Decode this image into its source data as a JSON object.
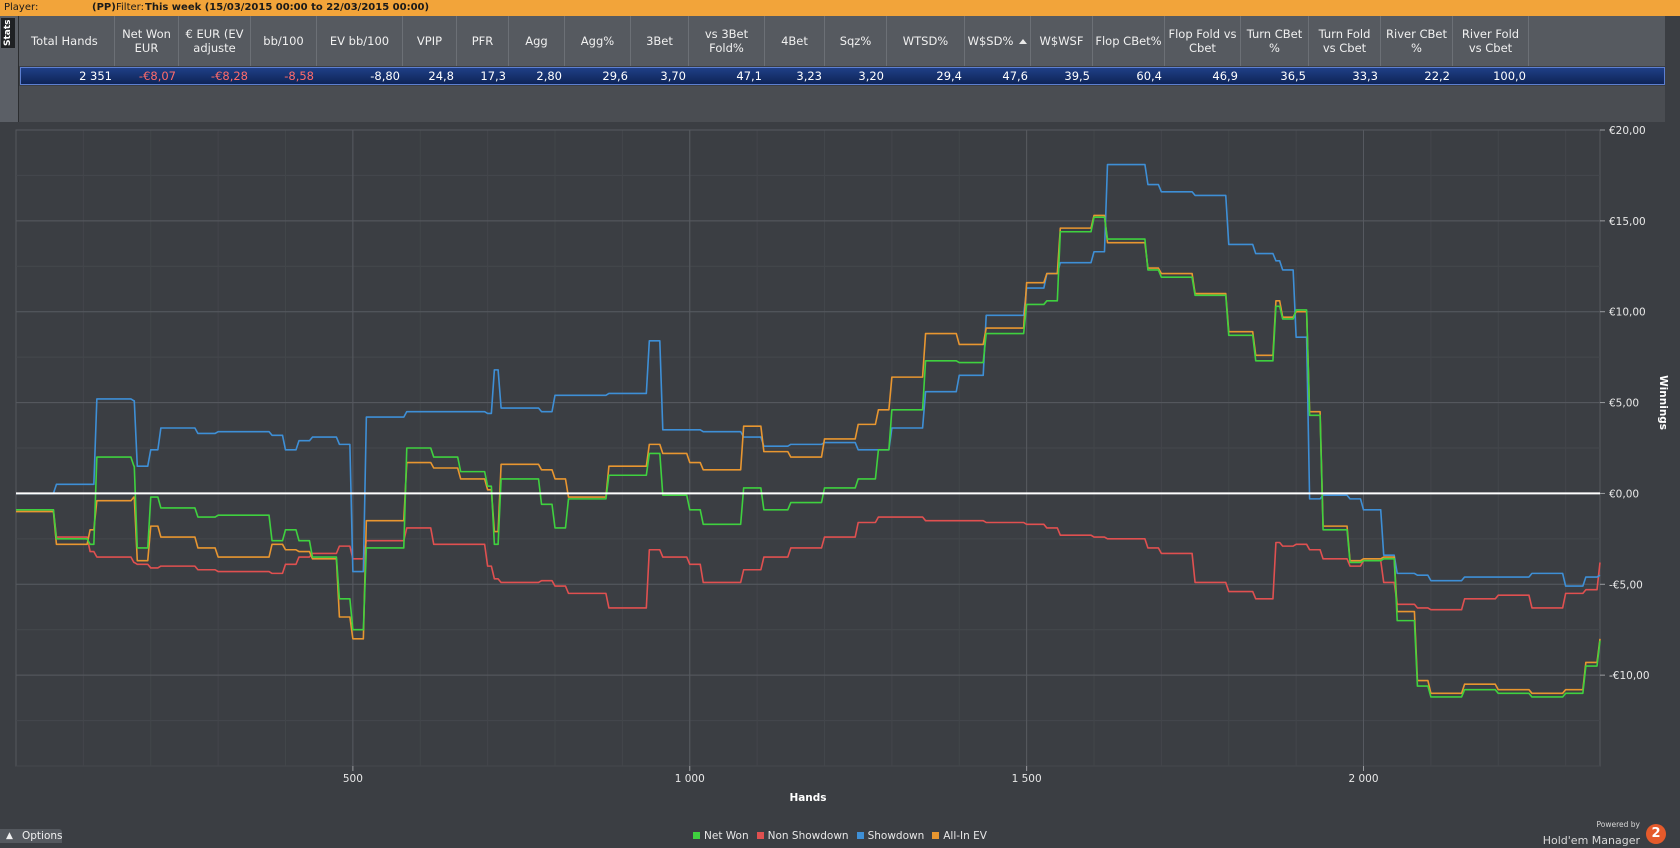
{
  "topbar": {
    "player_label": "Player:",
    "player_site": "(PP)",
    "filter_label": "Filter:",
    "filter_value": "This week (15/03/2015 00:00 to 22/03/2015 00:00)"
  },
  "side_tab": {
    "label": "Stats"
  },
  "stats": {
    "columns": [
      {
        "key": "total_hands",
        "label": "Total Hands"
      },
      {
        "key": "net_won",
        "label": "Net Won EUR"
      },
      {
        "key": "eur_ev",
        "label": "€ EUR (EV adjuste"
      },
      {
        "key": "bb100",
        "label": "bb/100"
      },
      {
        "key": "ev_bb100",
        "label": "EV bb/100"
      },
      {
        "key": "vpip",
        "label": "VPIP"
      },
      {
        "key": "pfr",
        "label": "PFR"
      },
      {
        "key": "agg",
        "label": "Agg"
      },
      {
        "key": "aggp",
        "label": "Agg%"
      },
      {
        "key": "threebet",
        "label": "3Bet"
      },
      {
        "key": "vs3bet",
        "label": "vs 3Bet Fold%"
      },
      {
        "key": "fourbet",
        "label": "4Bet"
      },
      {
        "key": "sqz",
        "label": "Sqz%"
      },
      {
        "key": "wtsd",
        "label": "WTSD%"
      },
      {
        "key": "wsd",
        "label": "W$SD%"
      },
      {
        "key": "wwsf",
        "label": "W$WSF"
      },
      {
        "key": "flop_cbet",
        "label": "Flop CBet%"
      },
      {
        "key": "flop_fold",
        "label": "Flop Fold vs Cbet"
      },
      {
        "key": "turn_cbet",
        "label": "Turn CBet %"
      },
      {
        "key": "turn_fold",
        "label": "Turn Fold vs Cbet"
      },
      {
        "key": "river_cbet",
        "label": "River CBet %"
      },
      {
        "key": "river_fold",
        "label": "River Fold vs Cbet"
      }
    ],
    "sorted_column": "W$SD%",
    "row": [
      "2 351",
      "-€8,07",
      "-€8,28",
      "-8,58",
      "-8,80",
      "24,8",
      "17,3",
      "2,80",
      "29,6",
      "3,70",
      "47,1",
      "3,23",
      "3,20",
      "29,4",
      "47,6",
      "39,5",
      "60,4",
      "46,9",
      "36,5",
      "33,3",
      "22,2",
      "100,0"
    ]
  },
  "chart_data": {
    "type": "line",
    "xlabel": "Hands",
    "ylabel": "Winnings",
    "xlim": [
      0,
      2351
    ],
    "ylim": [
      -15,
      20
    ],
    "x_ticks": [
      500,
      1000,
      1500,
      2000
    ],
    "x_tick_labels": [
      "500",
      "1 000",
      "1 500",
      "2 000"
    ],
    "y_ticks": [
      20,
      15,
      10,
      5,
      0,
      -5,
      -10
    ],
    "y_tick_labels": [
      "€20,00",
      "€15,00",
      "€10,00",
      "€5,00",
      "€0,00",
      "-€5,00",
      "-€10,00"
    ],
    "grid": true,
    "legend_position": "bottom-center",
    "x": [
      0,
      60,
      110,
      120,
      175,
      180,
      200,
      215,
      270,
      300,
      380,
      400,
      420,
      440,
      480,
      500,
      520,
      580,
      620,
      660,
      700,
      710,
      720,
      780,
      800,
      820,
      880,
      940,
      960,
      1000,
      1020,
      1080,
      1110,
      1150,
      1200,
      1250,
      1280,
      1300,
      1350,
      1400,
      1440,
      1500,
      1530,
      1550,
      1600,
      1620,
      1680,
      1700,
      1750,
      1800,
      1840,
      1870,
      1880,
      1900,
      1920,
      1940,
      1980,
      2000,
      2030,
      2050,
      2080,
      2100,
      2150,
      2200,
      2250,
      2300,
      2330,
      2351
    ],
    "series": [
      {
        "name": "Net Won",
        "color": "#3fd13f",
        "values": [
          -0.9,
          -2.5,
          -2.8,
          2.0,
          1.5,
          -3.0,
          -0.2,
          -0.8,
          -1.3,
          -1.2,
          -2.6,
          -2.0,
          -2.6,
          -3.5,
          -5.8,
          -7.5,
          -3.0,
          2.5,
          2.0,
          1.2,
          0.4,
          -2.8,
          0.8,
          -0.6,
          -1.9,
          -0.3,
          1.0,
          2.2,
          -0.1,
          -0.9,
          -1.7,
          0.3,
          -0.9,
          -0.5,
          0.3,
          0.8,
          2.4,
          4.6,
          7.3,
          7.2,
          8.8,
          10.4,
          10.6,
          14.4,
          15.2,
          14.0,
          12.3,
          11.9,
          10.9,
          8.7,
          7.3,
          10.3,
          9.6,
          10.1,
          4.3,
          -2.0,
          -3.8,
          -3.7,
          -3.6,
          -7.0,
          -10.6,
          -11.2,
          -10.8,
          -11.0,
          -11.2,
          -11.0,
          -9.5,
          -8.1
        ]
      },
      {
        "name": "Non Showdown",
        "color": "#e05050",
        "values": [
          -0.9,
          -2.4,
          -3.2,
          -3.5,
          -3.8,
          -3.9,
          -4.1,
          -4.0,
          -4.2,
          -4.3,
          -4.4,
          -3.9,
          -3.5,
          -3.3,
          -2.9,
          -3.6,
          -2.6,
          -1.9,
          -2.8,
          -2.8,
          -4.0,
          -4.7,
          -4.9,
          -4.8,
          -5.1,
          -5.5,
          -6.3,
          -3.1,
          -3.5,
          -3.9,
          -4.9,
          -4.2,
          -3.5,
          -3.0,
          -2.4,
          -1.6,
          -1.3,
          -1.3,
          -1.5,
          -1.5,
          -1.6,
          -1.7,
          -1.9,
          -2.3,
          -2.4,
          -2.5,
          -3.0,
          -3.3,
          -4.9,
          -5.4,
          -5.8,
          -2.7,
          -2.9,
          -2.8,
          -3.1,
          -3.6,
          -4.0,
          -3.7,
          -4.9,
          -6.1,
          -6.3,
          -6.4,
          -5.8,
          -5.6,
          -6.3,
          -5.5,
          -5.3,
          -3.8
        ]
      },
      {
        "name": "Showdown",
        "color": "#3e8fd6",
        "values": [
          0.0,
          0.5,
          0.5,
          5.2,
          5.1,
          1.5,
          2.4,
          3.6,
          3.3,
          3.4,
          3.2,
          2.4,
          2.9,
          3.1,
          2.7,
          -4.3,
          4.2,
          4.5,
          4.5,
          4.5,
          4.4,
          6.8,
          4.7,
          4.5,
          5.4,
          5.4,
          5.5,
          8.4,
          3.5,
          3.5,
          3.4,
          3.1,
          2.6,
          2.7,
          2.8,
          2.4,
          2.4,
          3.6,
          5.6,
          6.5,
          9.8,
          11.3,
          12.1,
          12.7,
          13.3,
          18.1,
          17.0,
          16.6,
          16.4,
          13.7,
          13.2,
          12.8,
          12.3,
          8.6,
          -0.3,
          -0.1,
          -0.3,
          -0.9,
          -3.4,
          -4.4,
          -4.5,
          -4.8,
          -4.6,
          -4.6,
          -4.4,
          -5.1,
          -4.6,
          -4.5
        ]
      },
      {
        "name": "All-In EV",
        "color": "#e89630",
        "values": [
          -1.0,
          -2.8,
          -2.0,
          -0.4,
          -0.2,
          -3.7,
          -1.8,
          -2.4,
          -3.0,
          -3.5,
          -2.8,
          -3.1,
          -3.2,
          -3.6,
          -6.8,
          -8.0,
          -1.5,
          1.7,
          1.4,
          0.8,
          0.2,
          -2.1,
          1.6,
          1.3,
          0.8,
          -0.2,
          1.5,
          2.7,
          2.2,
          1.7,
          1.3,
          3.7,
          2.3,
          2.0,
          3.0,
          3.8,
          4.6,
          6.4,
          8.8,
          8.2,
          9.1,
          11.6,
          12.1,
          14.6,
          15.3,
          13.8,
          12.4,
          12.1,
          11.0,
          8.9,
          7.6,
          10.6,
          9.7,
          10.0,
          4.5,
          -1.8,
          -3.7,
          -3.6,
          -3.5,
          -6.5,
          -10.3,
          -11.0,
          -10.5,
          -10.8,
          -11.0,
          -10.8,
          -9.3,
          -8.0
        ]
      }
    ]
  },
  "legend": [
    {
      "label": "Net Won",
      "color": "#3fd13f"
    },
    {
      "label": "Non Showdown",
      "color": "#e05050"
    },
    {
      "label": "Showdown",
      "color": "#3e8fd6"
    },
    {
      "label": "All-In EV",
      "color": "#e89630"
    }
  ],
  "options": {
    "label": "Options"
  },
  "footer": {
    "powered_by": "Powered by",
    "product": "Hold'em Manager",
    "logo_digit": "2"
  }
}
